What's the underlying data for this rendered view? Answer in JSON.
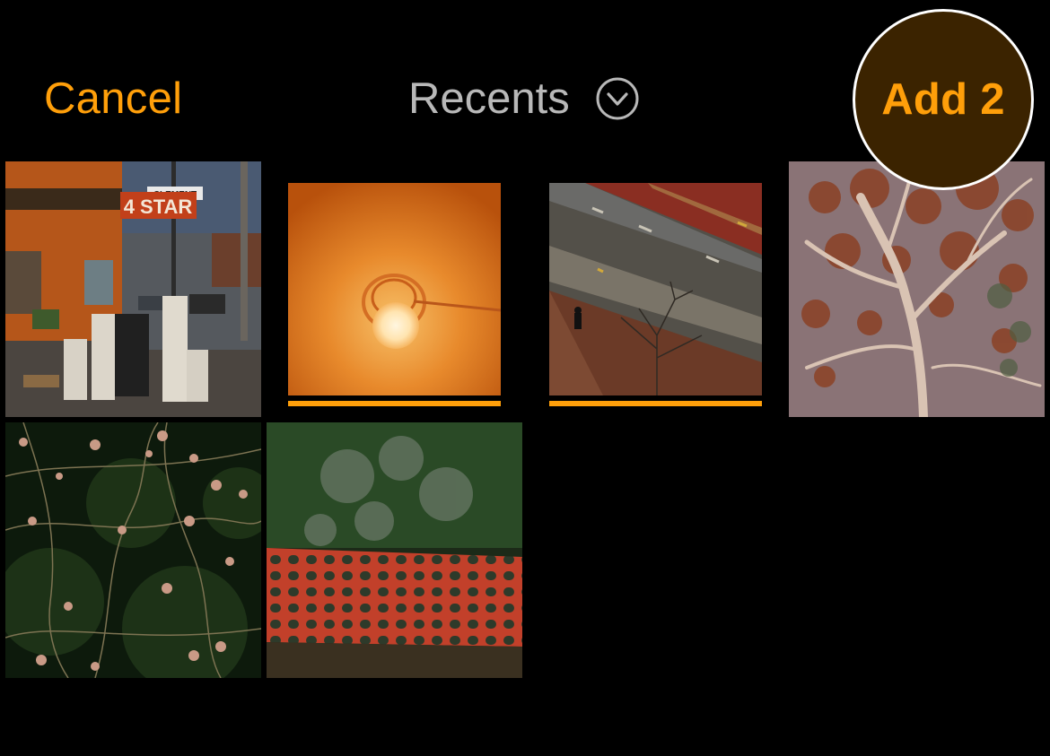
{
  "header": {
    "cancel_label": "Cancel",
    "album_label": "Recents",
    "add_label": "Add 2"
  },
  "colors": {
    "accent": "#ff9f0a",
    "background": "#000000",
    "title": "#b8b8b8",
    "highlight_fill": "#3b2300"
  },
  "photos": [
    {
      "label": "storefront-street",
      "selected": false,
      "sign": "CLEMENT",
      "store": "4 STAR"
    },
    {
      "label": "ceiling-light",
      "selected": true
    },
    {
      "label": "street-aerial",
      "selected": true
    },
    {
      "label": "tree-canopy",
      "selected": false
    },
    {
      "label": "flowering-branches",
      "selected": false
    },
    {
      "label": "orange-safety-net",
      "selected": false
    }
  ]
}
